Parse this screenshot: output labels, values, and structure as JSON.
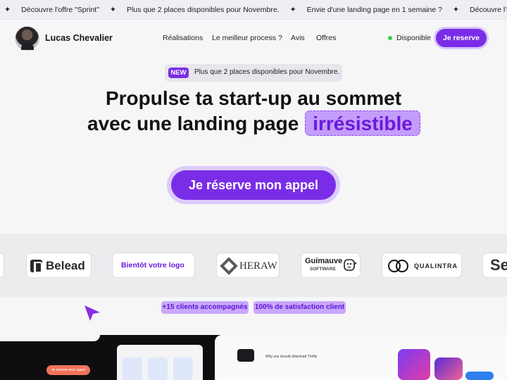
{
  "ticker": {
    "items": [
      "Découvre l'offre \"Sprint\"",
      "Plus que 2 places disponibles pour Novembre.",
      "Envie d'une landing page en 1 semaine ?",
      "Découvre l'offre \"Sprint\""
    ]
  },
  "header": {
    "name": "Lucas Chevalier",
    "nav": [
      "Réalisations",
      "Le meilleur process ?",
      "Avis",
      "Offres"
    ],
    "status": "Disponible",
    "reserve_label": "Je reserve",
    "colors": {
      "accent": "#7a2de6",
      "status": "#2fd34a"
    }
  },
  "badge": {
    "tag": "NEW",
    "text": "Plus que 2 places disponibles pour Novembre."
  },
  "hero": {
    "line1": "Propulse ta start-up au sommet",
    "line2": "avec une landing page",
    "highlight": "irrésistible",
    "cta": "Je réserve mon appel"
  },
  "logos": {
    "belead": "Belead",
    "placeholder": "Bientôt votre logo",
    "heraw": "HERAW",
    "guimauve": "Guimauve",
    "guimauve_sub": "SOFTWARE",
    "qualintra": "QUALINTRA",
    "partial": "Se"
  },
  "stats": {
    "clients": "+15 clients accompagnés",
    "satisfaction": "100% de satisfaction client"
  },
  "preview": {
    "button_label": "Je réserve mon appel",
    "question": "Why you should download Thrifty"
  }
}
